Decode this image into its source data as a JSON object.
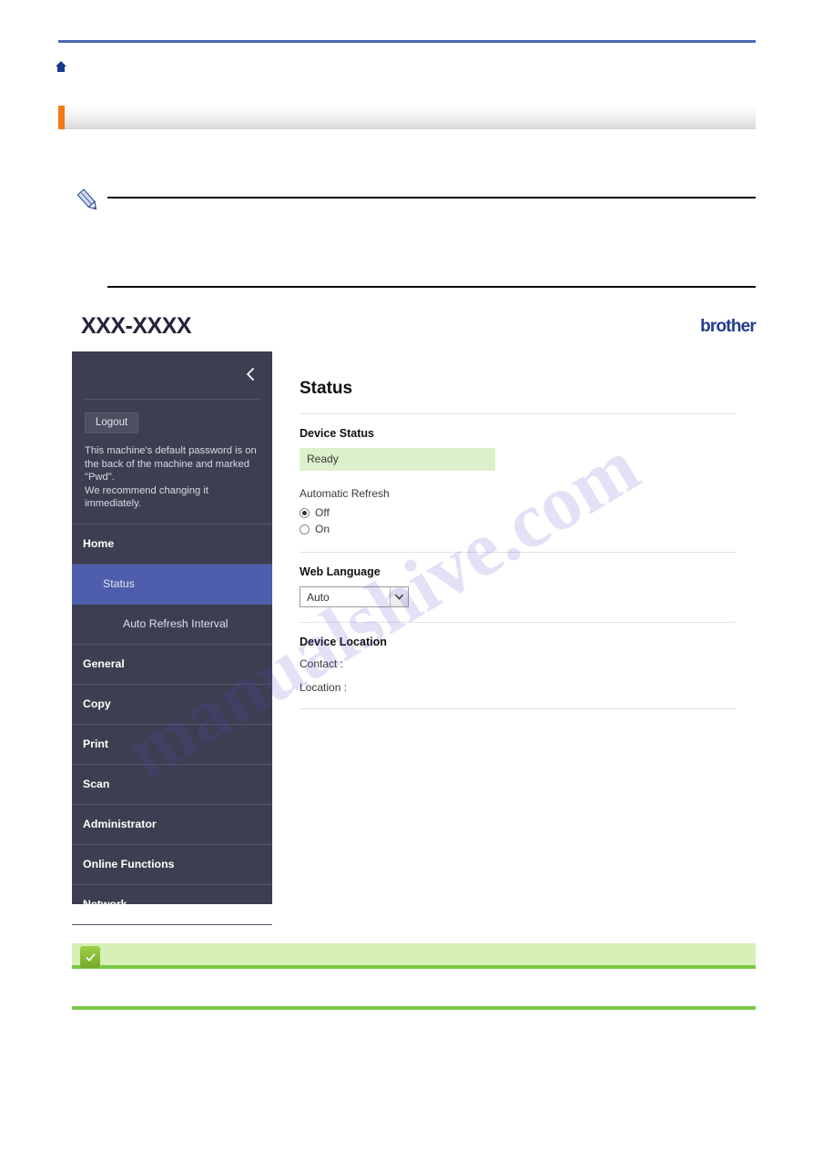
{
  "page": {
    "breadcrumb_icon": "home-icon",
    "title_bar_text": "",
    "note_text": "",
    "tip_text": "",
    "tip_body": "",
    "watermark": "manualshive.com"
  },
  "colors": {
    "top_rule": "#4a6bb5",
    "accent_orange": "#f47b14",
    "sidebar_bg": "#3e3e52",
    "nav_active": "#4e5ead",
    "status_green": "#ddf0cc",
    "tip_green": "#d6f0b8",
    "tip_border": "#7ac943",
    "brother_blue": "#243b8f",
    "home_icon": "#1a3a8f"
  },
  "figure": {
    "model_name": "XXX-XXXX",
    "brand_logo": "brother",
    "sidebar": {
      "collapse_icon": "chevron-left-icon",
      "logout_label": "Logout",
      "password_note": "This machine's default password is on\nthe back of the machine and marked\n\"Pwd\".\nWe recommend changing it\nimmediately.",
      "items": [
        {
          "label": "Home",
          "level": "top",
          "active": false
        },
        {
          "label": "Status",
          "level": "sub",
          "active": true
        },
        {
          "label": "Auto Refresh Interval",
          "level": "sub2",
          "active": false
        },
        {
          "label": "General",
          "level": "top",
          "active": false
        },
        {
          "label": "Copy",
          "level": "top",
          "active": false
        },
        {
          "label": "Print",
          "level": "top",
          "active": false
        },
        {
          "label": "Scan",
          "level": "top",
          "active": false
        },
        {
          "label": "Administrator",
          "level": "top",
          "active": false
        },
        {
          "label": "Online Functions",
          "level": "top",
          "active": false
        },
        {
          "label": "Network",
          "level": "top",
          "active": false
        }
      ]
    },
    "main": {
      "title": "Status",
      "device_status_label": "Device Status",
      "device_status_value": "Ready",
      "automatic_refresh_label": "Automatic Refresh",
      "refresh_options": [
        {
          "label": "Off",
          "selected": true
        },
        {
          "label": "On",
          "selected": false
        }
      ],
      "web_language_label": "Web Language",
      "web_language_value": "Auto",
      "device_location_label": "Device Location",
      "contact_label": "Contact :",
      "location_label": "Location :"
    }
  }
}
